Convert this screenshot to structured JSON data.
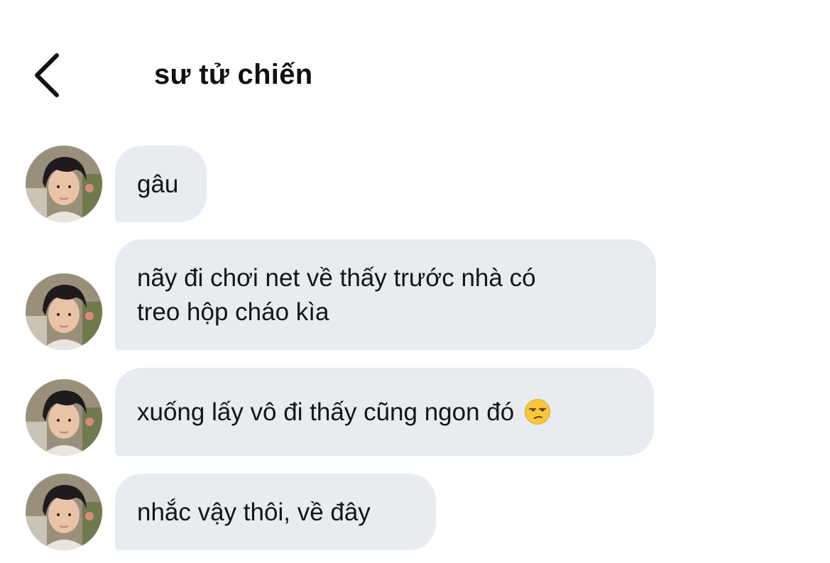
{
  "header": {
    "back_icon": "chevron-left-icon",
    "title": "sư tử chiến"
  },
  "messages": [
    {
      "text": "gâu"
    },
    {
      "lines": [
        "nãy đi chơi net về thấy trước nhà có",
        "treo hộp cháo kìa"
      ]
    },
    {
      "text": "xuống lấy vô đi thấy cũng ngon đó",
      "emoji": "unamused-face-icon"
    },
    {
      "text": "nhắc vậy thôi, về đây"
    }
  ],
  "colors": {
    "bubble_background": "#e8ebf0",
    "background": "#ffffff",
    "text": "#151515"
  }
}
